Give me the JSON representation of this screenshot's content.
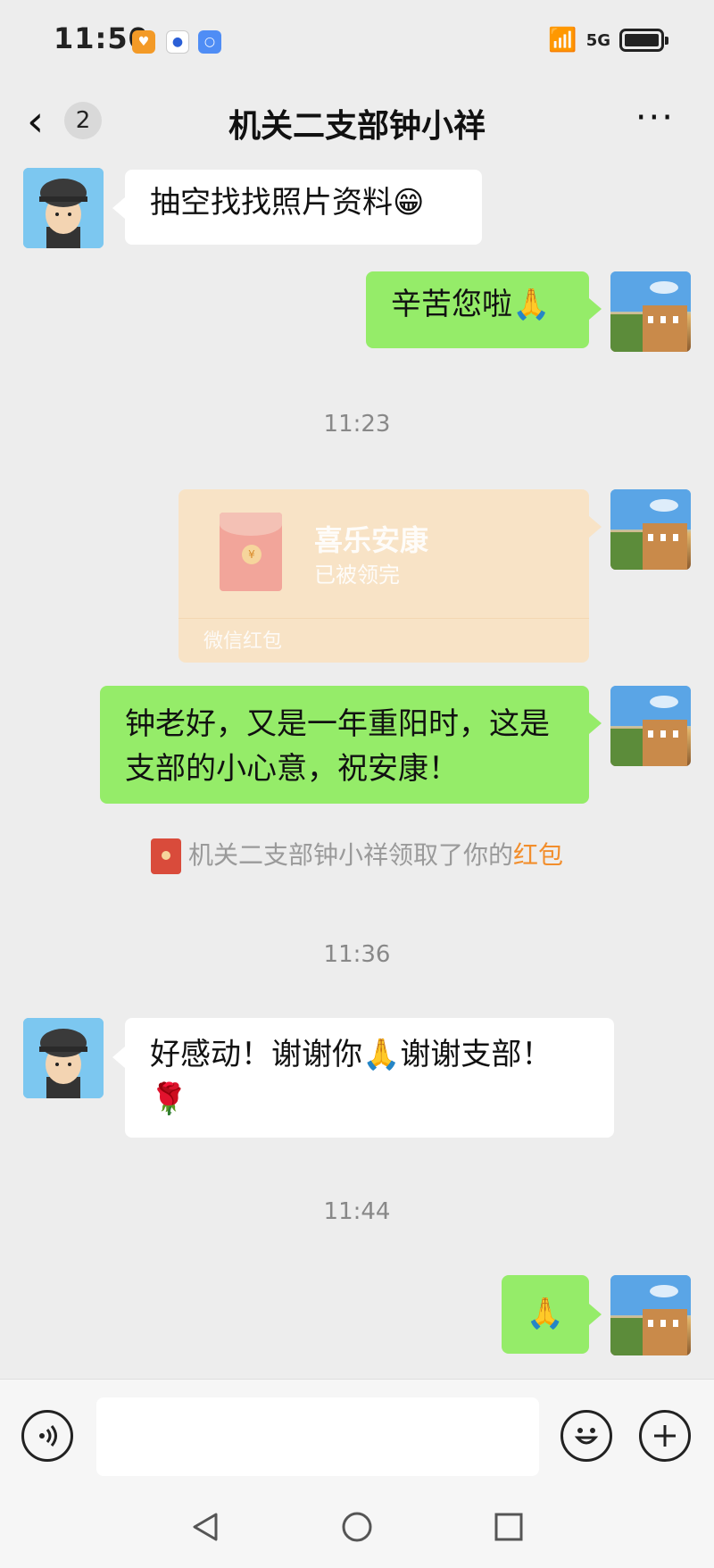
{
  "status_bar": {
    "time": "11:50",
    "network": "5G"
  },
  "header": {
    "unread_count": "2",
    "title": "机关二支部钟小祥",
    "more": "···"
  },
  "messages": {
    "m1": "抽空找找照片资料😁",
    "m2": "辛苦您啦🙏",
    "t1": "11:23",
    "packet_title": "喜乐安康",
    "packet_status": "已被领完",
    "packet_footer": "微信红包",
    "m3": "钟老好，又是一年重阳时，这是支部的小心意，祝安康！",
    "sys_prefix": "机关二支部钟小祥领取了你的",
    "sys_highlight": "红包",
    "t2": "11:36",
    "m4": "好感动！谢谢你🙏谢谢支部！🌹",
    "t3": "11:44",
    "m5": "🙏"
  },
  "colors": {
    "green_bubble": "#95ec69",
    "background": "#ededed",
    "red_packet": "#f8e3c6",
    "highlight": "#f28e2c"
  }
}
